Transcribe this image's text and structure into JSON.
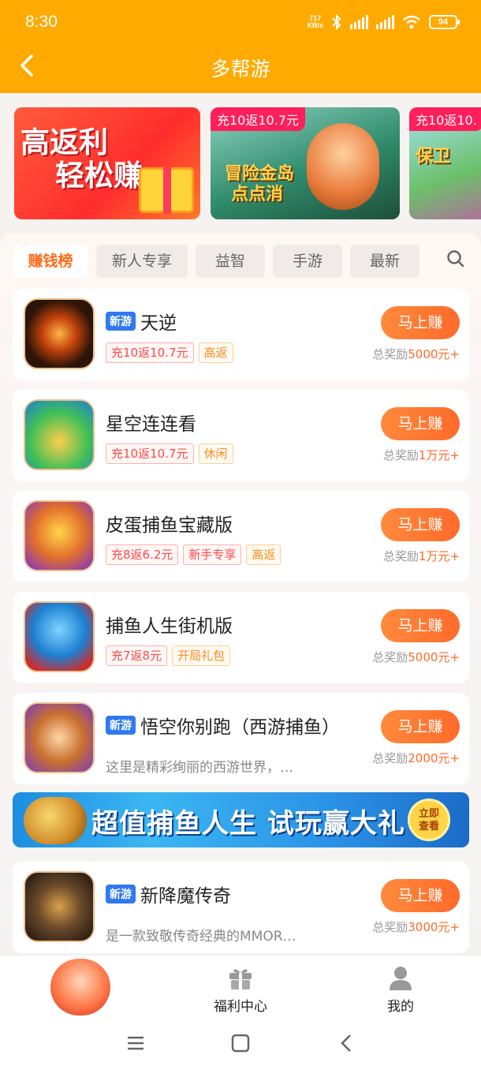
{
  "status_bar": {
    "time": "8:30",
    "net_speed_value": "717",
    "net_speed_unit": "KB/s",
    "battery": "94"
  },
  "header": {
    "title": "多帮游"
  },
  "banners": [
    {
      "line1": "高返利",
      "line2": "轻松赚"
    },
    {
      "tag": "充10返10.7元",
      "game_title_line1": "冒险金岛",
      "game_title_line2": "点点消"
    },
    {
      "tag": "充10返10.",
      "game_title": "保卫"
    }
  ],
  "tabs": [
    "赚钱榜",
    "新人专享",
    "益智",
    "手游",
    "最新"
  ],
  "games": [
    {
      "is_new": true,
      "new_label": "新游",
      "name": "天逆",
      "tags": [
        {
          "text": "充10返10.7元",
          "style": "red"
        },
        {
          "text": "高返",
          "style": "orange"
        }
      ],
      "button": "马上赚",
      "reward_prefix": "总奖励",
      "reward_amount": "5000元+"
    },
    {
      "is_new": false,
      "name": "星空连连看",
      "tags": [
        {
          "text": "充10返10.7元",
          "style": "red"
        },
        {
          "text": "休闲",
          "style": "orange"
        }
      ],
      "button": "马上赚",
      "reward_prefix": "总奖励",
      "reward_amount": "1万元+"
    },
    {
      "is_new": false,
      "name": "皮蛋捕鱼宝藏版",
      "tags": [
        {
          "text": "充8返6.2元",
          "style": "red"
        },
        {
          "text": "新手专享",
          "style": "red"
        },
        {
          "text": "高返",
          "style": "orange"
        }
      ],
      "button": "马上赚",
      "reward_prefix": "总奖励",
      "reward_amount": "1万元+"
    },
    {
      "is_new": false,
      "name": "捕鱼人生街机版",
      "tags": [
        {
          "text": "充7返8元",
          "style": "red"
        },
        {
          "text": "开局礼包",
          "style": "orange"
        }
      ],
      "button": "马上赚",
      "reward_prefix": "总奖励",
      "reward_amount": "5000元+"
    },
    {
      "is_new": true,
      "new_label": "新游",
      "name": "悟空你别跑（西游捕鱼）",
      "description": "这里是精彩绚丽的西游世界，…",
      "button": "马上赚",
      "reward_prefix": "总奖励",
      "reward_amount": "2000元+"
    },
    {
      "is_new": true,
      "new_label": "新游",
      "name": "新降魔传奇",
      "description": "是一款致敬传奇经典的MMOR…",
      "button": "马上赚",
      "reward_prefix": "总奖励",
      "reward_amount": "3000元+"
    }
  ],
  "ad": {
    "text": "超值捕鱼人生 试玩赢大礼",
    "button_line1": "立即",
    "button_line2": "查看"
  },
  "bottom_nav": {
    "welfare": "福利中心",
    "mine": "我的"
  },
  "colors": {
    "header": "#ffaa00",
    "accent": "#ff6a2a",
    "new_badge": "#2f79f0"
  }
}
